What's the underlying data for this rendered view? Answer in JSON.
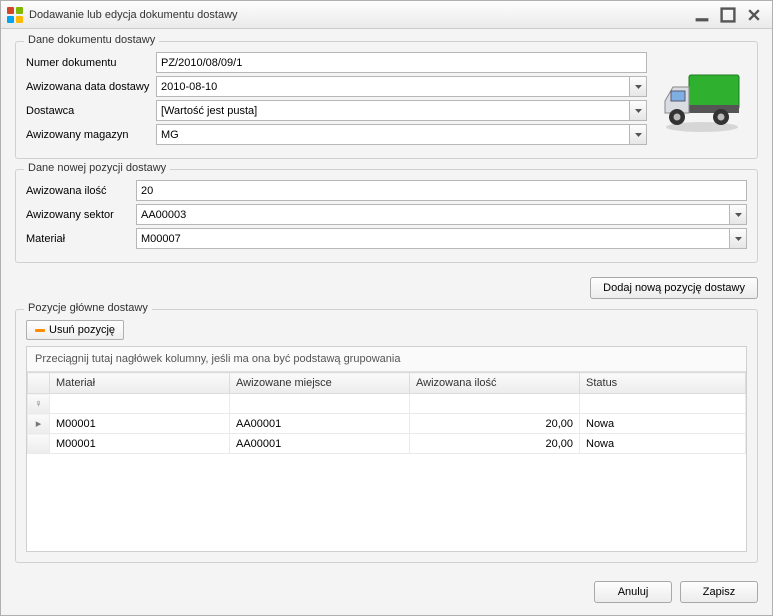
{
  "window": {
    "title": "Dodawanie lub edycja dokumentu dostawy"
  },
  "group_doc": {
    "title": "Dane dokumentu dostawy",
    "fields": {
      "docnum_label": "Numer dokumentu",
      "docnum_value": "PZ/2010/08/09/1",
      "date_label": "Awizowana data dostawy",
      "date_value": "2010-08-10",
      "supplier_label": "Dostawca",
      "supplier_value": "[Wartość jest pusta]",
      "warehouse_label": "Awizowany magazyn",
      "warehouse_value": "MG"
    }
  },
  "group_new": {
    "title": "Dane nowej pozycji dostawy",
    "fields": {
      "qty_label": "Awizowana ilość",
      "qty_value": "20",
      "sector_label": "Awizowany sektor",
      "sector_value": "AA00003",
      "material_label": "Materiał",
      "material_value": "M00007"
    },
    "add_button": "Dodaj nową pozycję dostawy"
  },
  "group_items": {
    "title": "Pozycje główne dostawy",
    "delete_button": "Usuń pozycję",
    "groupby_hint": "Przeciągnij tutaj nagłówek kolumny, jeśli ma ona być podstawą grupowania",
    "columns": {
      "material": "Materiał",
      "place": "Awizowane miejsce",
      "qty": "Awizowana ilość",
      "status": "Status"
    },
    "rows": [
      {
        "material": "M00001",
        "place": "AA00001",
        "qty": "20,00",
        "status": "Nowa",
        "current": true
      },
      {
        "material": "M00001",
        "place": "AA00001",
        "qty": "20,00",
        "status": "Nowa",
        "current": false
      }
    ]
  },
  "buttons": {
    "cancel": "Anuluj",
    "save": "Zapisz"
  },
  "icons": {
    "filter_glyph": "♀",
    "row_marker": "▸"
  }
}
